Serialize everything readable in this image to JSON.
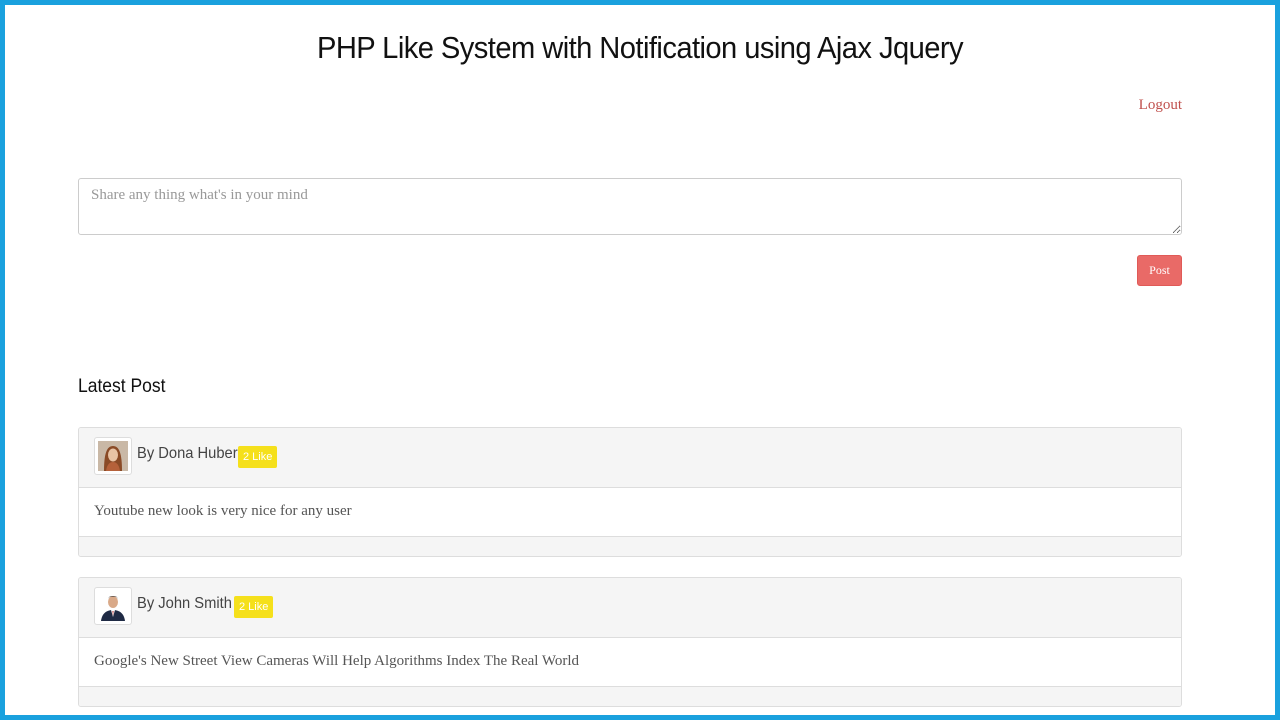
{
  "header": {
    "title": "PHP Like System with Notification using Ajax Jquery"
  },
  "nav": {
    "logout_label": "Logout"
  },
  "composer": {
    "placeholder": "Share any thing what's in your mind",
    "value": "",
    "post_label": "Post"
  },
  "feed": {
    "title": "Latest Post",
    "posts": [
      {
        "author": "By Dona Huber",
        "likes": "2 Like",
        "content": "Youtube new look is very nice for any user",
        "avatar_icon": "woman-portrait"
      },
      {
        "author": "By John Smith",
        "likes": "2 Like",
        "content": "Google's New Street View Cameras Will Help Algorithms Index The Real World",
        "avatar_icon": "man-portrait"
      }
    ]
  },
  "colors": {
    "frame": "#1aa1de",
    "accent": "#e96a67",
    "badge": "#f5e01b",
    "link": "#c0504d"
  }
}
